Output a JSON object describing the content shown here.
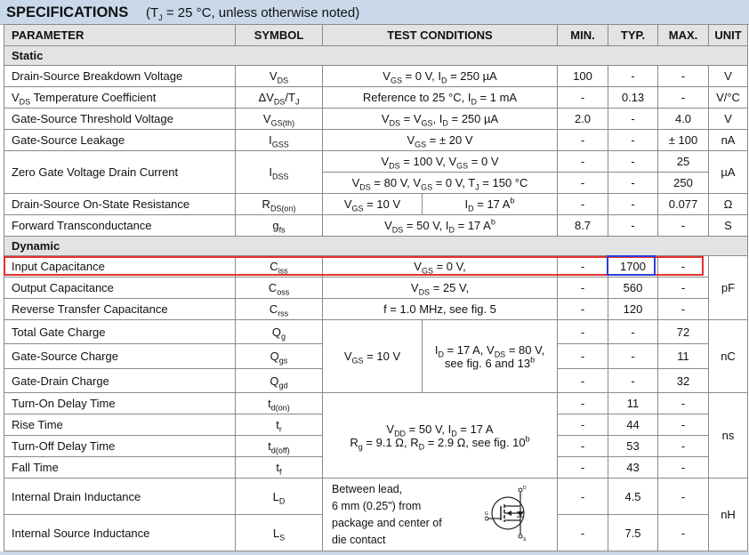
{
  "title": {
    "main": "SPECIFICATIONS",
    "cond": "(T<sub>J</sub> = 25 °C, unless otherwise noted)"
  },
  "headers": [
    "PARAMETER",
    "SYMBOL",
    "TEST CONDITIONS",
    "MIN.",
    "TYP.",
    "MAX.",
    "UNIT"
  ],
  "sections": {
    "static": "Static",
    "dynamic": "Dynamic"
  },
  "rows": {
    "bvds": {
      "param": "Drain-Source Breakdown Voltage",
      "sym": "V<sub>DS</sub>",
      "cond": "V<sub>GS</sub> = 0 V, I<sub>D</sub> = 250 µA",
      "min": "100",
      "typ": "-",
      "max": "-",
      "unit": "V"
    },
    "vdstc": {
      "param": "V<sub>DS</sub> Temperature Coefficient",
      "sym": "ΔV<sub>DS</sub>/T<sub>J</sub>",
      "cond": "Reference to 25 °C, I<sub>D</sub> = 1 mA",
      "min": "-",
      "typ": "0.13",
      "max": "-",
      "unit": "V/°C"
    },
    "vgsth": {
      "param": "Gate-Source Threshold Voltage",
      "sym": "V<sub>GS(th)</sub>",
      "cond": "V<sub>DS</sub> = V<sub>GS</sub>, I<sub>D</sub> = 250 µA",
      "min": "2.0",
      "typ": "-",
      "max": "4.0",
      "unit": "V"
    },
    "igss": {
      "param": "Gate-Source Leakage",
      "sym": "I<sub>GSS</sub>",
      "cond": "V<sub>GS</sub> = ± 20 V",
      "min": "-",
      "typ": "-",
      "max": "± 100",
      "unit": "nA"
    },
    "idss": {
      "param": "Zero Gate Voltage Drain Current",
      "sym": "I<sub>DSS</sub>",
      "cond1": "V<sub>DS</sub> = 100 V, V<sub>GS</sub> = 0 V",
      "cond2": "V<sub>DS</sub> = 80 V, V<sub>GS</sub> = 0 V, T<sub>J</sub> = 150 °C",
      "min1": "-",
      "typ1": "-",
      "max1": "25",
      "min2": "-",
      "typ2": "-",
      "max2": "250",
      "unit": "µA"
    },
    "rdson": {
      "param": "Drain-Source On-State Resistance",
      "sym": "R<sub>DS(on)</sub>",
      "cond_a": "V<sub>GS</sub> = 10 V",
      "cond_b": "I<sub>D</sub> = 17 A<sup>b</sup>",
      "min": "-",
      "typ": "-",
      "max": "0.077",
      "unit": "Ω"
    },
    "gfs": {
      "param": "Forward Transconductance",
      "sym": "g<sub>fs</sub>",
      "cond": "V<sub>DS</sub> = 50 V, I<sub>D</sub> = 17 A<sup>b</sup>",
      "min": "8.7",
      "typ": "-",
      "max": "-",
      "unit": "S"
    },
    "ciss": {
      "param": "Input Capacitance",
      "sym": "C<sub>iss</sub>",
      "cond": "V<sub>GS</sub> = 0 V,",
      "min": "-",
      "typ": "1700",
      "max": "-"
    },
    "coss": {
      "param": "Output Capacitance",
      "sym": "C<sub>oss</sub>",
      "cond": "V<sub>DS</sub> = 25 V,",
      "min": "-",
      "typ": "560",
      "max": "-"
    },
    "crss": {
      "param": "Reverse Transfer Capacitance",
      "sym": "C<sub>rss</sub>",
      "cond": "f = 1.0 MHz, see fig. 5",
      "min": "-",
      "typ": "120",
      "max": "-"
    },
    "cap_unit": "pF",
    "qg": {
      "param": "Total Gate Charge",
      "sym": "Q<sub>g</sub>",
      "min": "-",
      "typ": "-",
      "max": "72"
    },
    "qgs": {
      "param": "Gate-Source Charge",
      "sym": "Q<sub>gs</sub>",
      "min": "-",
      "typ": "-",
      "max": "11"
    },
    "qgd": {
      "param": "Gate-Drain Charge",
      "sym": "Q<sub>gd</sub>",
      "min": "-",
      "typ": "-",
      "max": "32"
    },
    "q_cond_a": "V<sub>GS</sub> = 10 V",
    "q_cond_b": "I<sub>D</sub> = 17 A, V<sub>DS</sub> = 80 V,<br>see fig. 6 and 13<sup>b</sup>",
    "q_unit": "nC",
    "tdon": {
      "param": "Turn-On Delay Time",
      "sym": "t<sub>d(on)</sub>",
      "min": "-",
      "typ": "11",
      "max": "-"
    },
    "tr": {
      "param": "Rise Time",
      "sym": "t<sub>r</sub>",
      "min": "-",
      "typ": "44",
      "max": "-"
    },
    "tdoff": {
      "param": "Turn-Off Delay Time",
      "sym": "t<sub>d(off)</sub>",
      "min": "-",
      "typ": "53",
      "max": "-"
    },
    "tf": {
      "param": "Fall Time",
      "sym": "t<sub>f</sub>",
      "min": "-",
      "typ": "43",
      "max": "-"
    },
    "t_cond": "V<sub>DD</sub> = 50 V, I<sub>D</sub> = 17 A<br>R<sub>g</sub> = 9.1 Ω, R<sub>D</sub> = 2.9 Ω, see fig. 10<sup>b</sup>",
    "t_unit": "ns",
    "ld": {
      "param": "Internal Drain Inductance",
      "sym": "L<sub>D</sub>",
      "min": "-",
      "typ": "4.5",
      "max": "-"
    },
    "ls": {
      "param": "Internal Source Inductance",
      "sym": "L<sub>S</sub>",
      "min": "-",
      "typ": "7.5",
      "max": "-"
    },
    "l_cond": "Between lead,<br>6 mm (0.25\") from<br>package and center of<br>die contact",
    "l_unit": "nH",
    "mosfet_pins": [
      "D",
      "G",
      "S"
    ]
  }
}
